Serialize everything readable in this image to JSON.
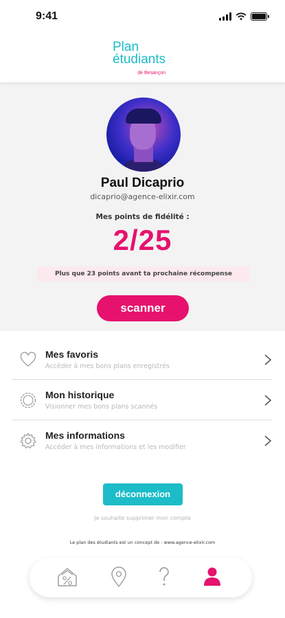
{
  "status_bar": {
    "time": "9:41"
  },
  "logo": {
    "line1": "Plan",
    "line2": "étudiants",
    "line3": "de Besançon"
  },
  "profile": {
    "name": "Paul Dicaprio",
    "email": "dicaprio@agence-elixir.com",
    "points_label": "Mes points de fidélité :",
    "points_value": "2/25",
    "remaining_text": "Plus que 23 points avant ta prochaine récompense",
    "scan_label": "scanner"
  },
  "menu": [
    {
      "icon": "heart-icon",
      "title": "Mes favoris",
      "subtitle": "Accéder à mes bons plans enregistrés"
    },
    {
      "icon": "history-icon",
      "title": "Mon historique",
      "subtitle": "Visionner mes bons plans scannés"
    },
    {
      "icon": "gear-icon",
      "title": "Mes informations",
      "subtitle": "Accéder à mes informations et les modifier"
    }
  ],
  "logout_label": "déconnexion",
  "delete_account": "Je souhaite supprimer mon compte",
  "concept_text": "Le plan des étudiants est un concept de : www.agence-elixir.com",
  "bottom_nav": [
    {
      "icon": "discount-house-icon",
      "active": false
    },
    {
      "icon": "map-pin-icon",
      "active": false
    },
    {
      "icon": "help-icon",
      "active": false
    },
    {
      "icon": "profile-icon",
      "active": true
    }
  ],
  "colors": {
    "pink": "#e6126d",
    "teal": "#1cbcc8",
    "background": "#f3f3f3"
  }
}
